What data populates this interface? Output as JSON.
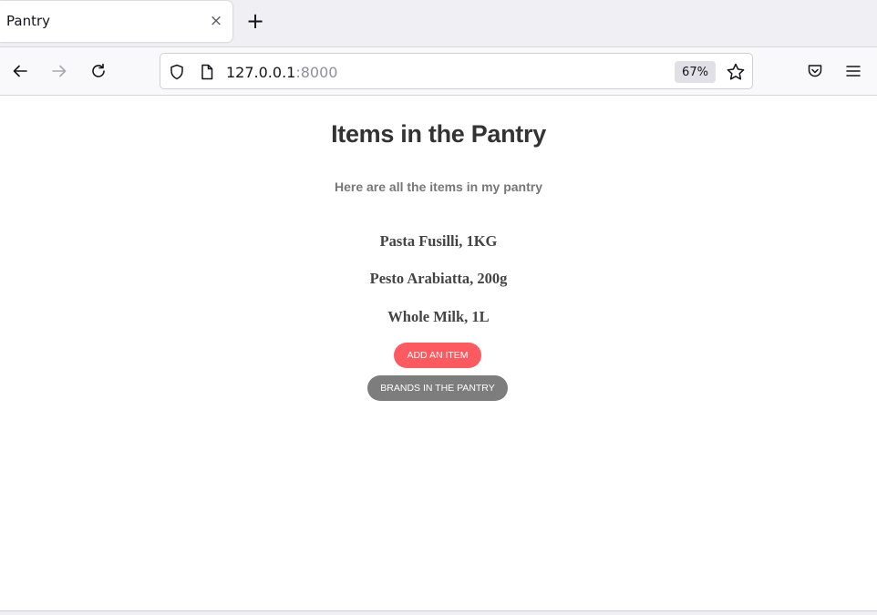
{
  "browser": {
    "tab": {
      "title": "Pantry",
      "close_glyph": "×"
    },
    "new_tab_glyph": "+",
    "url": {
      "host": "127.0.0.1",
      "port": ":8000"
    },
    "zoom": "67%",
    "icons": [
      "back-arrow-icon",
      "forward-arrow-icon",
      "reload-icon",
      "shield-icon",
      "page-icon",
      "star-icon",
      "pocket-icon",
      "menu-icon"
    ]
  },
  "page": {
    "title": "Items in the Pantry",
    "subtitle": "Here are all the items in my pantry",
    "items": [
      "Pasta Fusilli, 1KG",
      "Pesto Arabiatta, 200g",
      "Whole Milk, 1L"
    ],
    "buttons": {
      "add_item": "ADD AN ITEM",
      "brands": "BRANDS IN THE PANTRY"
    },
    "colors": {
      "add_button": "#ff5a5f",
      "brands_button": "#7d7d7d"
    }
  }
}
